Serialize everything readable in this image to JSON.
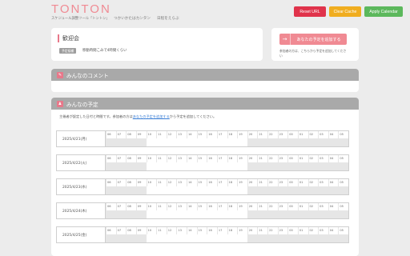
{
  "header": {
    "logo_text": "TONTON",
    "logo_subtitle": "スケジュール調整ツール「トントン」",
    "nav": [
      "つかいかたはカンタン",
      "日程をえらぶ"
    ],
    "buttons": {
      "reset": "Reset URL",
      "clear": "Clear Cache",
      "apply": "Apply Calendar"
    },
    "colors": {
      "reset": "#e0334b",
      "clear": "#f0ad1f",
      "apply": "#5cb85c",
      "accent": "#f08a93"
    }
  },
  "event": {
    "title": "歓迎会",
    "tag": "予定候補",
    "tag_value": "移動時間こみで4時間くらい"
  },
  "side": {
    "add_label": "あなたの予定を追加する",
    "note": "参加者の方は、こちらから予定を追加してください"
  },
  "comments": {
    "header": "みんなのコメント"
  },
  "schedule": {
    "header": "みんなの予定",
    "intro_prefix": "主催者が設定した日付と時間です。参加者の方は",
    "intro_link": "あなたの予定を追加する",
    "intro_suffix": "から予定を追加してください。",
    "hours": [
      "06",
      "07",
      "08",
      "09",
      "10",
      "11",
      "12",
      "13",
      "14",
      "15",
      "16",
      "17",
      "18",
      "19",
      "20",
      "21",
      "22",
      "23",
      "00",
      "01",
      "02",
      "03",
      "04",
      "05"
    ],
    "days": [
      {
        "date": "2025/4/21(月)"
      },
      {
        "date": "2025/4/22(火)"
      },
      {
        "date": "2025/4/23(水)"
      },
      {
        "date": "2025/4/24(木)"
      },
      {
        "date": "2025/4/25(金)"
      }
    ]
  }
}
